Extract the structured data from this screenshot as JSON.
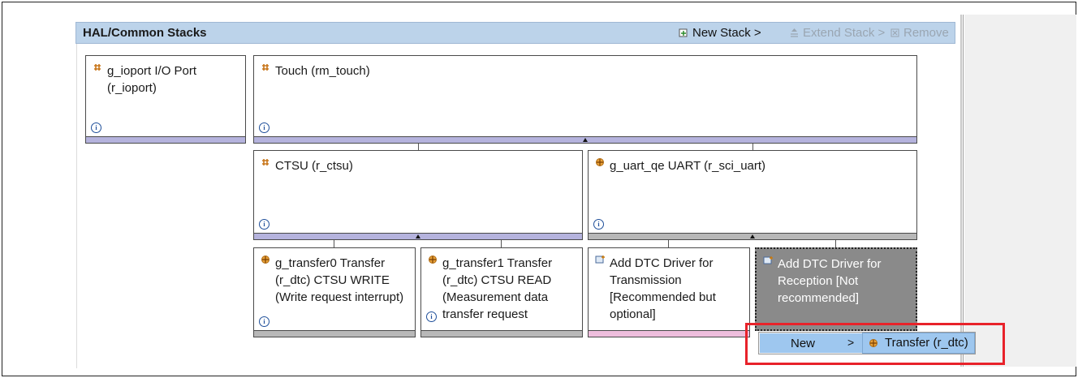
{
  "header": {
    "title": "HAL/Common Stacks",
    "new_stack": "New Stack >",
    "extend_stack": "Extend Stack >",
    "remove": "Remove"
  },
  "blocks": {
    "ioport": "g_ioport I/O Port\n(r_ioport)",
    "touch": "Touch (rm_touch)",
    "ctsu": "CTSU (r_ctsu)",
    "uart": "g_uart_qe UART (r_sci_uart)",
    "transfer0": "g_transfer0 Transfer\n(r_dtc) CTSU WRITE\n(Write request interrupt)",
    "transfer1": "g_transfer1 Transfer\n(r_dtc) CTSU READ\n(Measurement data\ntransfer request",
    "dtc_tx": "Add DTC Driver for\nTransmission\n[Recommended but\noptional]",
    "dtc_rx": "Add DTC Driver for\nReception [Not\nrecommended]"
  },
  "info_glyph": "i",
  "context_menu": {
    "new_label": "New",
    "arrow": ">",
    "submenu_item": "Transfer (r_dtc)"
  },
  "colors": {
    "header_bg": "#bcd3ea",
    "purple_bar": "#b5b3dd",
    "gray_bar": "#b8b8b8",
    "pink_bar": "#eebedd",
    "selected_block": "#8a8a8a",
    "menu_highlight": "#9ec7ef",
    "annotation_red": "#e8222a"
  },
  "icons": [
    "new-stack-icon",
    "extend-stack-icon",
    "remove-icon",
    "module-icon",
    "add-driver-icon",
    "info-icon",
    "transfer-icon"
  ]
}
